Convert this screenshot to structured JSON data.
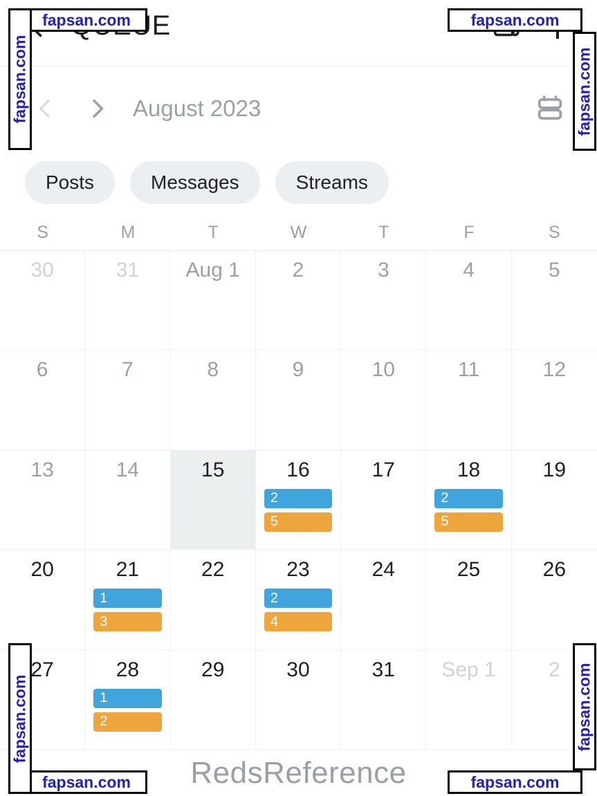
{
  "appbar": {
    "back_icon": "arrow-left-icon",
    "title": "QUEUE",
    "schedule_icon": "queue-list-icon",
    "add_icon": "plus-icon"
  },
  "monthnav": {
    "prev_icon": "chevron-left-icon",
    "next_icon": "chevron-right-icon",
    "label": "August 2023",
    "view_toggle_icon": "calendar-view-icon"
  },
  "filters": {
    "tabs": [
      {
        "label": "Posts"
      },
      {
        "label": "Messages"
      },
      {
        "label": "Streams"
      }
    ]
  },
  "calendar": {
    "weekdays": [
      "S",
      "M",
      "T",
      "W",
      "T",
      "F",
      "S"
    ],
    "weeks": [
      [
        {
          "label": "30",
          "state": "muted",
          "events": []
        },
        {
          "label": "31",
          "state": "muted",
          "events": []
        },
        {
          "label": "Aug 1",
          "state": "past",
          "events": []
        },
        {
          "label": "2",
          "state": "past",
          "events": []
        },
        {
          "label": "3",
          "state": "past",
          "events": []
        },
        {
          "label": "4",
          "state": "past",
          "events": []
        },
        {
          "label": "5",
          "state": "past",
          "events": []
        }
      ],
      [
        {
          "label": "6",
          "state": "past",
          "events": []
        },
        {
          "label": "7",
          "state": "past",
          "events": []
        },
        {
          "label": "8",
          "state": "past",
          "events": []
        },
        {
          "label": "9",
          "state": "past",
          "events": []
        },
        {
          "label": "10",
          "state": "past",
          "events": []
        },
        {
          "label": "11",
          "state": "past",
          "events": []
        },
        {
          "label": "12",
          "state": "past",
          "events": []
        }
      ],
      [
        {
          "label": "13",
          "state": "past",
          "events": []
        },
        {
          "label": "14",
          "state": "past",
          "events": []
        },
        {
          "label": "15",
          "state": "today",
          "events": []
        },
        {
          "label": "16",
          "state": "current",
          "events": [
            {
              "count": "2",
              "color": "blue"
            },
            {
              "count": "5",
              "color": "orange"
            }
          ]
        },
        {
          "label": "17",
          "state": "current",
          "events": []
        },
        {
          "label": "18",
          "state": "current",
          "events": [
            {
              "count": "2",
              "color": "blue"
            },
            {
              "count": "5",
              "color": "orange"
            }
          ]
        },
        {
          "label": "19",
          "state": "current",
          "events": []
        }
      ],
      [
        {
          "label": "20",
          "state": "current",
          "events": []
        },
        {
          "label": "21",
          "state": "current",
          "events": [
            {
              "count": "1",
              "color": "blue"
            },
            {
              "count": "3",
              "color": "orange"
            }
          ]
        },
        {
          "label": "22",
          "state": "current",
          "events": []
        },
        {
          "label": "23",
          "state": "current",
          "events": [
            {
              "count": "2",
              "color": "blue"
            },
            {
              "count": "4",
              "color": "orange"
            }
          ]
        },
        {
          "label": "24",
          "state": "current",
          "events": []
        },
        {
          "label": "25",
          "state": "current",
          "events": []
        },
        {
          "label": "26",
          "state": "current",
          "events": []
        }
      ],
      [
        {
          "label": "27",
          "state": "current",
          "events": []
        },
        {
          "label": "28",
          "state": "current",
          "events": [
            {
              "count": "1",
              "color": "blue"
            },
            {
              "count": "2",
              "color": "orange"
            }
          ]
        },
        {
          "label": "29",
          "state": "current",
          "events": []
        },
        {
          "label": "30",
          "state": "current",
          "events": []
        },
        {
          "label": "31",
          "state": "current",
          "events": []
        },
        {
          "label": "Sep 1",
          "state": "muted",
          "events": []
        },
        {
          "label": "2",
          "state": "muted",
          "events": []
        }
      ]
    ]
  },
  "footer": {
    "brand": "RedsReference"
  },
  "watermarks": {
    "text": "fapsan.com"
  },
  "colors": {
    "event_blue": "#41a5dd",
    "event_orange": "#eea53c",
    "pill_bg": "#eceff1",
    "today_bg": "#eceff0",
    "muted_text": "#cfd3d6",
    "past_text": "#9aa0a6",
    "watermark_text": "#2222bb"
  }
}
